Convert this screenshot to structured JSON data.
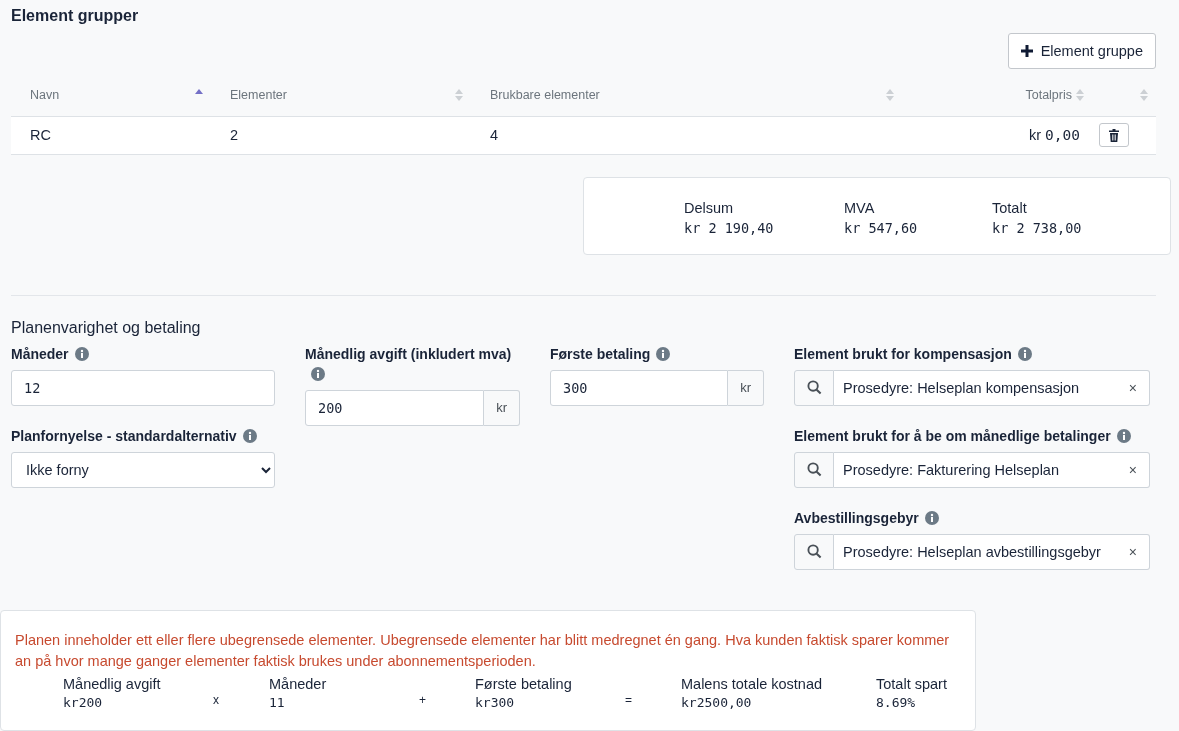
{
  "groups": {
    "title": "Element grupper",
    "add_button": "Element gruppe",
    "columns": [
      {
        "kind": "text",
        "label": "Navn",
        "sorted": true
      },
      {
        "kind": "text",
        "label": "Elementer",
        "sorted": false
      },
      {
        "kind": "text",
        "label": "Brukbare elementer",
        "sorted": false
      },
      {
        "kind": "amount",
        "label": "Totalpris",
        "sorted": false
      },
      {
        "kind": "action",
        "sorted": false
      }
    ],
    "rows": [
      {
        "cells": [
          "RC",
          "2",
          "4",
          "kr 0,00"
        ]
      }
    ]
  },
  "summary": [
    {
      "label": "Delsum",
      "value": "kr 2 190,40"
    },
    {
      "label": "MVA",
      "value": "kr 547,60"
    },
    {
      "label": "Totalt",
      "value": "kr 2 738,00"
    }
  ],
  "plan": {
    "title": "Planenvarighet og betaling",
    "columns": [
      [
        {
          "kind": "text",
          "label": "Måneder",
          "value": "12"
        },
        {
          "kind": "select",
          "label": "Planfornyelse - standardalternativ",
          "value": "Ikke forny"
        }
      ],
      [
        {
          "kind": "addon",
          "label": "Månedlig avgift (inkludert mva)",
          "value": "200",
          "addon": "kr"
        }
      ],
      [
        {
          "kind": "addon",
          "label": "Første betaling",
          "value": "300",
          "addon": "kr"
        }
      ],
      [
        {
          "kind": "lookup",
          "label": "Element brukt for kompensasjon",
          "value": "Prosedyre: Helseplan kompensasjon",
          "clear": "×"
        },
        {
          "kind": "lookup",
          "label": "Element brukt for å be om månedlige betalinger",
          "value": "Prosedyre: Fakturering Helseplan",
          "clear": "×"
        },
        {
          "kind": "lookup",
          "label": "Avbestillingsgebyr",
          "value": "Prosedyre: Helseplan avbestillingsgebyr",
          "clear": "×"
        }
      ]
    ]
  },
  "notice": {
    "warning": "Planen inneholder ett eller flere ubegrensede elementer. Ubegrensede elementer har blitt medregnet én gang. Hva kunden faktisk sparer kommer an på hvor mange ganger elementer faktisk brukes under abonnementsperioden.",
    "formula": [
      {
        "kind": "term",
        "label": "Månedlig avgift",
        "value": "kr200"
      },
      {
        "kind": "operator",
        "text": "x"
      },
      {
        "kind": "term",
        "label": "Måneder",
        "value": "11"
      },
      {
        "kind": "operator",
        "text": "+"
      },
      {
        "kind": "term",
        "label": "Første betaling",
        "value": "kr300"
      },
      {
        "kind": "operator",
        "text": "="
      },
      {
        "kind": "term",
        "label": "Malens totale kostnad",
        "value": "kr2500,00"
      },
      {
        "kind": "term",
        "label": "Totalt spart",
        "value": "8.69%"
      }
    ]
  }
}
